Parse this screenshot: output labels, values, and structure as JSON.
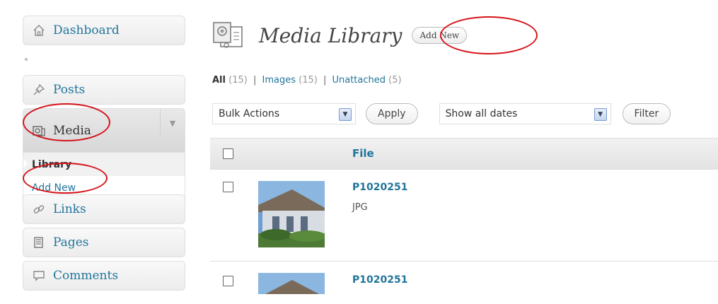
{
  "sidebar": {
    "items": [
      {
        "label": "Dashboard",
        "icon": "home-icon"
      },
      {
        "label": "Posts",
        "icon": "pushpin-icon"
      },
      {
        "label": "Media",
        "icon": "media-icon"
      },
      {
        "label": "Links",
        "icon": "link-icon"
      },
      {
        "label": "Pages",
        "icon": "pages-icon"
      },
      {
        "label": "Comments",
        "icon": "comment-icon"
      }
    ],
    "media_submenu": {
      "library": "Library",
      "add_new": "Add New"
    },
    "toggle_glyph": "▼"
  },
  "header": {
    "title": "Media Library",
    "add_new": "Add New"
  },
  "filters": {
    "all": "All",
    "all_count": "(15)",
    "images": "Images",
    "images_count": "(15)",
    "unattached": "Unattached",
    "unattached_count": "(5)",
    "sep": "|"
  },
  "tablenav": {
    "bulk_actions": "Bulk Actions",
    "apply": "Apply",
    "dates": "Show all dates",
    "filter": "Filter"
  },
  "table": {
    "header_file": "File",
    "rows": [
      {
        "name": "P1020251",
        "type": "JPG"
      },
      {
        "name": "P1020251",
        "type": ""
      }
    ]
  },
  "colors": {
    "link": "#21759b",
    "annotation": "#d4141a"
  }
}
